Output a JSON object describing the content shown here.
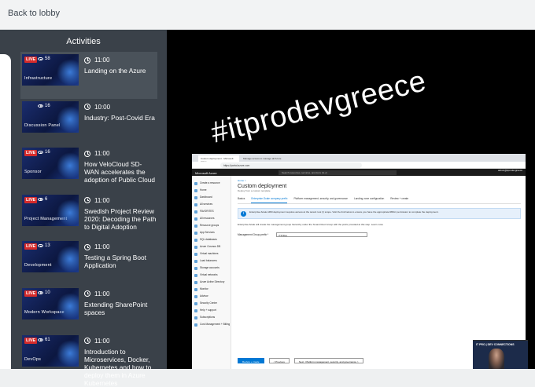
{
  "header": {
    "back_label": "Back to lobby"
  },
  "sidebar": {
    "title": "Activities",
    "items": [
      {
        "live": "LIVE",
        "viewers": "58",
        "thumb_title": "Infrastructure",
        "time": "11:00",
        "title": "Landing on the Azure",
        "active": true
      },
      {
        "live": "",
        "viewers": "16",
        "thumb_title": "Discussion Panel",
        "time": "10:00",
        "title": "Industry: Post-Covid Era",
        "active": false
      },
      {
        "live": "LIVE",
        "viewers": "16",
        "thumb_title": "Sponsor",
        "time": "11:00",
        "title": "How VeloCloud SD-WAN accelerates the adoption of Public Cloud",
        "active": false
      },
      {
        "live": "LIVE",
        "viewers": "6",
        "thumb_title": "Project Management",
        "time": "11:00",
        "title": "Swedish Project Review 2020: Decoding the Path to Digital Adoption",
        "active": false
      },
      {
        "live": "LIVE",
        "viewers": "13",
        "thumb_title": "Development",
        "time": "11:00",
        "title": "Testing a Spring Boot Application",
        "active": false
      },
      {
        "live": "LIVE",
        "viewers": "10",
        "thumb_title": "Modern Workspace",
        "time": "11:00",
        "title": "Extending SharePoint spaces",
        "active": false
      },
      {
        "live": "LIVE",
        "viewers": "61",
        "thumb_title": "DevOps",
        "time": "11:00",
        "title": "Introduction to Microservices, Docker, Kubernetes and how to deploy them in Azure Kubernetes",
        "active": false
      }
    ]
  },
  "video": {
    "hashtag": "#itprodevgreece",
    "browser": {
      "tab1": "Custom deployment - Microsoft Azure",
      "tab2": "Manage access to manage all Azure",
      "url": "https://portal.azure.com",
      "brand": "Microsoft Azure",
      "search_placeholder": "Search resources, services, and docs (G+/)",
      "user": "admin@itprodevgreece",
      "nav": [
        "Create a resource",
        "Home",
        "Dashboard",
        "All services",
        "FAVORITES",
        "All resources",
        "Resource groups",
        "App Services",
        "SQL databases",
        "Azure Cosmos DB",
        "Virtual machines",
        "Load balancers",
        "Storage accounts",
        "Virtual networks",
        "Azure Active Directory",
        "Monitor",
        "Advisor",
        "Security Center",
        "Help + support",
        "Subscriptions",
        "Cost Management + Billing"
      ],
      "crumb": "Home >",
      "heading": "Custom deployment",
      "subheading": "Deploy from a custom template",
      "steps": [
        "Basics",
        "Enterprise-Scale company prefix",
        "Platform management, security, and governance",
        "Landing zone configuration",
        "Review + create"
      ],
      "info": "Enterprise-Scale ARM deployment requires access at the tenant root (/) scope. Visit the link below to ensure you have the appropriate RBAC permission to complete the deployment.",
      "para": "Enterprise-Scale will create the management group hierarchy under the Tenant Root Group with the prefix provided at this step. Learn more",
      "field_label": "Management Group prefix *",
      "field_value": "ITPrDev",
      "buttons": [
        "Review + create",
        "< Previous",
        "Next : Platform management, security, and governance >"
      ]
    },
    "webcam_badge": "IT PRO | DEV CONNECTIONS"
  }
}
